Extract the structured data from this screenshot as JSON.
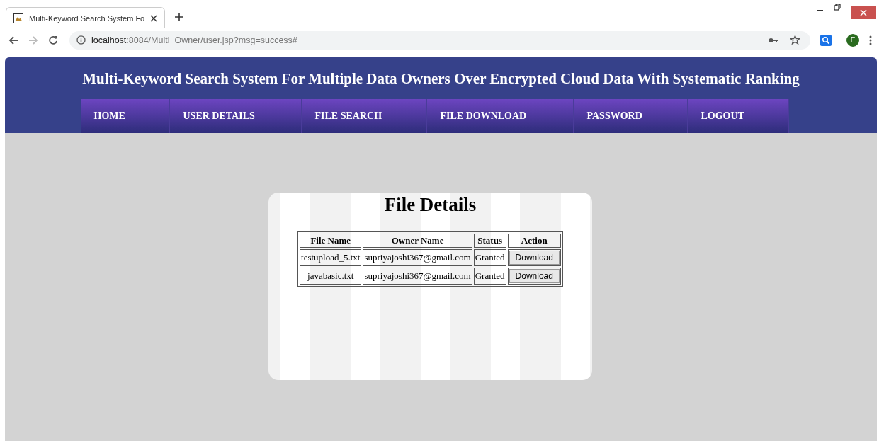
{
  "browser": {
    "tab_title": "Multi-Keyword Search System Fo",
    "url_host": "localhost",
    "url_rest": ":8084/Multi_Owner/user.jsp?msg=success#",
    "profile_initial": "E"
  },
  "header": {
    "title": "Multi-Keyword Search System For Multiple Data Owners Over Encrypted Cloud Data With Systematic Ranking"
  },
  "nav": [
    "HOME",
    "USER DETAILS",
    "FILE SEARCH",
    "FILE DOWNLOAD",
    "PASSWORD",
    "LOGOUT"
  ],
  "panel": {
    "title": "File Details",
    "columns": [
      "File Name",
      "Owner Name",
      "Status",
      "Action"
    ],
    "rows": [
      {
        "file_name": "testupload_5.txt",
        "owner": "supriyajoshi367@gmail.com",
        "status": "Granted",
        "action": "Download"
      },
      {
        "file_name": "javabasic.txt",
        "owner": "supriyajoshi367@gmail.com",
        "status": "Granted",
        "action": "Download"
      }
    ]
  }
}
